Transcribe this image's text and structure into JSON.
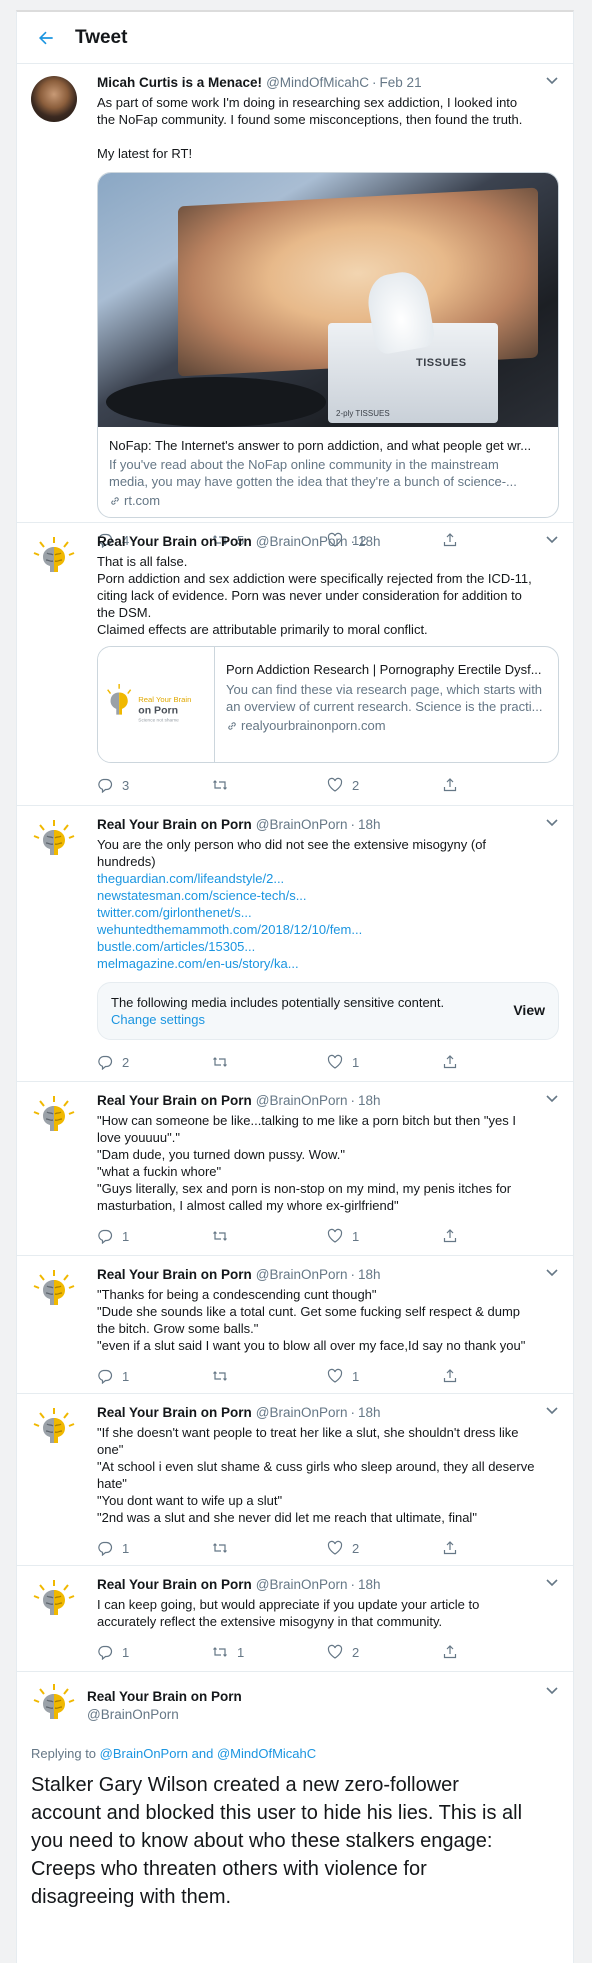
{
  "header": {
    "title": "Tweet"
  },
  "tweets": [
    {
      "name": "Micah Curtis is a Menace!",
      "handle": "@MindOfMicahC",
      "time": "Feb 21",
      "lines": [
        "As part of some work I'm doing in researching sex addiction, I looked into",
        "the NoFap community. I found some misconceptions, then found the truth.",
        "",
        "My latest for RT!"
      ],
      "card": {
        "image_texts": [
          "TISSUES",
          "2-ply TISSUES"
        ],
        "title": "NoFap: The Internet's answer to porn addiction, and what people get wr...",
        "desc1": "If you've read about the NoFap online community in the mainstream",
        "desc2": "media, you may have gotten the idea that they're a bunch of science-...",
        "domain": "rt.com"
      },
      "replies": "4",
      "retweets": "5",
      "likes": "12"
    },
    {
      "name": "Real Your Brain on Porn",
      "handle": "@BrainOnPorn",
      "time": "18h",
      "lines": [
        "That is all false.",
        "Porn addiction and sex addiction were specifically rejected from the ICD-11,",
        "citing lack of evidence. Porn was never under consideration for addition to",
        "the DSM.",
        "Claimed effects are attributable primarily to moral conflict."
      ],
      "card": {
        "logo_line1": "Real Your Brain",
        "logo_line2": "on Porn",
        "logo_line3": "Science not shame",
        "title": "Porn Addiction Research | Pornography Erectile Dysf...",
        "desc1": "You can find these via research page, which starts with",
        "desc2": "an overview of current research. Science is the practi...",
        "domain": "realyourbrainonporn.com"
      },
      "replies": "3",
      "retweets": "",
      "likes": "2"
    },
    {
      "name": "Real Your Brain on Porn",
      "handle": "@BrainOnPorn",
      "time": "18h",
      "lines": [
        "You are the only person who did not see the extensive misogyny (of",
        "hundreds)"
      ],
      "links": [
        "theguardian.com/lifeandstyle/2...",
        "newstatesman.com/science-tech/s...",
        "twitter.com/girlonthenet/s...",
        "wehuntedthemammoth.com/2018/12/10/fem...",
        "bustle.com/articles/15305...",
        "melmagazine.com/en-us/story/ka..."
      ],
      "sensitive": {
        "text": "The following media includes potentially sensitive content.",
        "link": "Change settings",
        "view": "View"
      },
      "replies": "2",
      "retweets": "",
      "likes": "1"
    },
    {
      "name": "Real Your Brain on Porn",
      "handle": "@BrainOnPorn",
      "time": "18h",
      "lines": [
        "\"How can someone be like...talking to me like a porn bitch but then \"yes I",
        "love youuuu\".\"",
        "\"Dam dude, you turned down pussy. Wow.\"",
        "\"what a fuckin whore\"",
        "\"Guys literally, sex and porn is non-stop on my mind, my penis itches for",
        "masturbation, I almost called my whore ex-girlfriend\""
      ],
      "replies": "1",
      "retweets": "",
      "likes": "1"
    },
    {
      "name": "Real Your Brain on Porn",
      "handle": "@BrainOnPorn",
      "time": "18h",
      "lines": [
        "\"Thanks for being a condescending cunt though\"",
        "\"Dude she sounds like a total cunt. Get some fucking self respect & dump",
        "the bitch. Grow some balls.\"",
        "\"even if a slut said I want you to blow all over my face,Id say no thank you\""
      ],
      "replies": "1",
      "retweets": "",
      "likes": "1"
    },
    {
      "name": "Real Your Brain on Porn",
      "handle": "@BrainOnPorn",
      "time": "18h",
      "lines": [
        "\"If she doesn't want people to treat her like a slut, she shouldn't dress like",
        "one\"",
        "\"At school i even slut shame & cuss girls who sleep around, they all deserve",
        "hate\"",
        "\"You dont want to wife up a slut\"",
        "\"2nd was a slut and she never did let me reach that ultimate, final\""
      ],
      "replies": "1",
      "retweets": "",
      "likes": "2"
    },
    {
      "name": "Real Your Brain on Porn",
      "handle": "@BrainOnPorn",
      "time": "18h",
      "lines": [
        "I can keep going, but would appreciate if you update your article to",
        "accurately reflect the extensive misogyny in that community."
      ],
      "replies": "1",
      "retweets": "1",
      "likes": "2"
    }
  ],
  "main": {
    "name": "Real Your Brain on Porn",
    "handle": "@BrainOnPorn",
    "replying_prefix": "Replying to",
    "replying_to_1": "@BrainOnPorn",
    "replying_and": "and",
    "replying_to_2": "@MindOfMicahC",
    "text_lines": [
      "Stalker Gary Wilson created a new zero-follower",
      "account and blocked this user to hide his lies. This is all",
      "you need to know about who these stalkers engage:",
      "Creeps who threaten others with violence for",
      "disagreeing with them."
    ]
  },
  "colors": {
    "accent": "#1b95e0",
    "secondary_text": "#657786",
    "border": "#e6ecf0"
  }
}
